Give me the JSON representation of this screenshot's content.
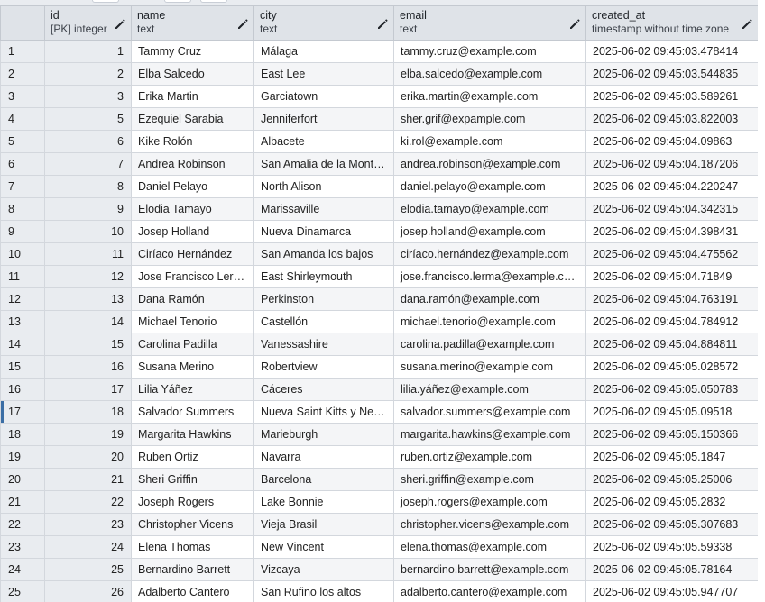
{
  "columns": [
    {
      "name": "id",
      "type": "[PK] integer"
    },
    {
      "name": "name",
      "type": "text"
    },
    {
      "name": "city",
      "type": "text"
    },
    {
      "name": "email",
      "type": "text"
    },
    {
      "name": "created_at",
      "type": "timestamp without time zone"
    }
  ],
  "icons": {
    "edit": "pencil-icon"
  },
  "selected_row": "17",
  "rows": [
    {
      "n": "1",
      "id": "1",
      "name": "Tammy Cruz",
      "city": "Málaga",
      "email": "tammy.cruz@example.com",
      "created_at": "2025-06-02 09:45:03.478414"
    },
    {
      "n": "2",
      "id": "2",
      "name": "Elba Salcedo",
      "city": "East Lee",
      "email": "elba.salcedo@example.com",
      "created_at": "2025-06-02 09:45:03.544835"
    },
    {
      "n": "3",
      "id": "3",
      "name": "Erika Martin",
      "city": "Garciatown",
      "email": "erika.martin@example.com",
      "created_at": "2025-06-02 09:45:03.589261"
    },
    {
      "n": "4",
      "id": "5",
      "name": "Ezequiel Sarabia",
      "city": "Jenniferfort",
      "email": "sher.grif@expample.com",
      "created_at": "2025-06-02 09:45:03.822003"
    },
    {
      "n": "5",
      "id": "6",
      "name": "Kike Rolón",
      "city": "Albacete",
      "email": "ki.rol@example.com",
      "created_at": "2025-06-02 09:45:04.09863"
    },
    {
      "n": "6",
      "id": "7",
      "name": "Andrea Robinson",
      "city": "San Amalia de la Montaña",
      "email": "andrea.robinson@example.com",
      "created_at": "2025-06-02 09:45:04.187206"
    },
    {
      "n": "7",
      "id": "8",
      "name": "Daniel Pelayo",
      "city": "North Alison",
      "email": "daniel.pelayo@example.com",
      "created_at": "2025-06-02 09:45:04.220247"
    },
    {
      "n": "8",
      "id": "9",
      "name": "Elodia Tamayo",
      "city": "Marissaville",
      "email": "elodia.tamayo@example.com",
      "created_at": "2025-06-02 09:45:04.342315"
    },
    {
      "n": "9",
      "id": "10",
      "name": "Josep Holland",
      "city": "Nueva Dinamarca",
      "email": "josep.holland@example.com",
      "created_at": "2025-06-02 09:45:04.398431"
    },
    {
      "n": "10",
      "id": "11",
      "name": "Ciríaco Hernández",
      "city": "San Amanda los bajos",
      "email": "ciríaco.hernández@example.com",
      "created_at": "2025-06-02 09:45:04.475562"
    },
    {
      "n": "11",
      "id": "12",
      "name": "Jose Francisco Lerma",
      "city": "East Shirleymouth",
      "email": "jose.francisco.lerma@example.com",
      "created_at": "2025-06-02 09:45:04.71849"
    },
    {
      "n": "12",
      "id": "13",
      "name": "Dana Ramón",
      "city": "Perkinston",
      "email": "dana.ramón@example.com",
      "created_at": "2025-06-02 09:45:04.763191"
    },
    {
      "n": "13",
      "id": "14",
      "name": "Michael Tenorio",
      "city": "Castellón",
      "email": "michael.tenorio@example.com",
      "created_at": "2025-06-02 09:45:04.784912"
    },
    {
      "n": "14",
      "id": "15",
      "name": "Carolina Padilla",
      "city": "Vanessashire",
      "email": "carolina.padilla@example.com",
      "created_at": "2025-06-02 09:45:04.884811"
    },
    {
      "n": "15",
      "id": "16",
      "name": "Susana Merino",
      "city": "Robertview",
      "email": "susana.merino@example.com",
      "created_at": "2025-06-02 09:45:05.028572"
    },
    {
      "n": "16",
      "id": "17",
      "name": "Lilia Yáñez",
      "city": "Cáceres",
      "email": "lilia.yáñez@example.com",
      "created_at": "2025-06-02 09:45:05.050783"
    },
    {
      "n": "17",
      "id": "18",
      "name": "Salvador Summers",
      "city": "Nueva Saint Kitts y Nevis",
      "email": "salvador.summers@example.com",
      "created_at": "2025-06-02 09:45:05.09518"
    },
    {
      "n": "18",
      "id": "19",
      "name": "Margarita Hawkins",
      "city": "Marieburgh",
      "email": "margarita.hawkins@example.com",
      "created_at": "2025-06-02 09:45:05.150366"
    },
    {
      "n": "19",
      "id": "20",
      "name": "Ruben Ortiz",
      "city": "Navarra",
      "email": "ruben.ortiz@example.com",
      "created_at": "2025-06-02 09:45:05.1847"
    },
    {
      "n": "20",
      "id": "21",
      "name": "Sheri Griffin",
      "city": "Barcelona",
      "email": "sheri.griffin@example.com",
      "created_at": "2025-06-02 09:45:05.25006"
    },
    {
      "n": "21",
      "id": "22",
      "name": "Joseph Rogers",
      "city": "Lake Bonnie",
      "email": "joseph.rogers@example.com",
      "created_at": "2025-06-02 09:45:05.2832"
    },
    {
      "n": "22",
      "id": "23",
      "name": "Christopher Vicens",
      "city": "Vieja Brasil",
      "email": "christopher.vicens@example.com",
      "created_at": "2025-06-02 09:45:05.307683"
    },
    {
      "n": "23",
      "id": "24",
      "name": "Elena Thomas",
      "city": "New Vincent",
      "email": "elena.thomas@example.com",
      "created_at": "2025-06-02 09:45:05.59338"
    },
    {
      "n": "24",
      "id": "25",
      "name": "Bernardino Barrett",
      "city": "Vizcaya",
      "email": "bernardino.barrett@example.com",
      "created_at": "2025-06-02 09:45:05.78164"
    },
    {
      "n": "25",
      "id": "26",
      "name": "Adalberto Cantero",
      "city": "San Rufino los altos",
      "email": "adalberto.cantero@example.com",
      "created_at": "2025-06-02 09:45:05.947707"
    }
  ]
}
